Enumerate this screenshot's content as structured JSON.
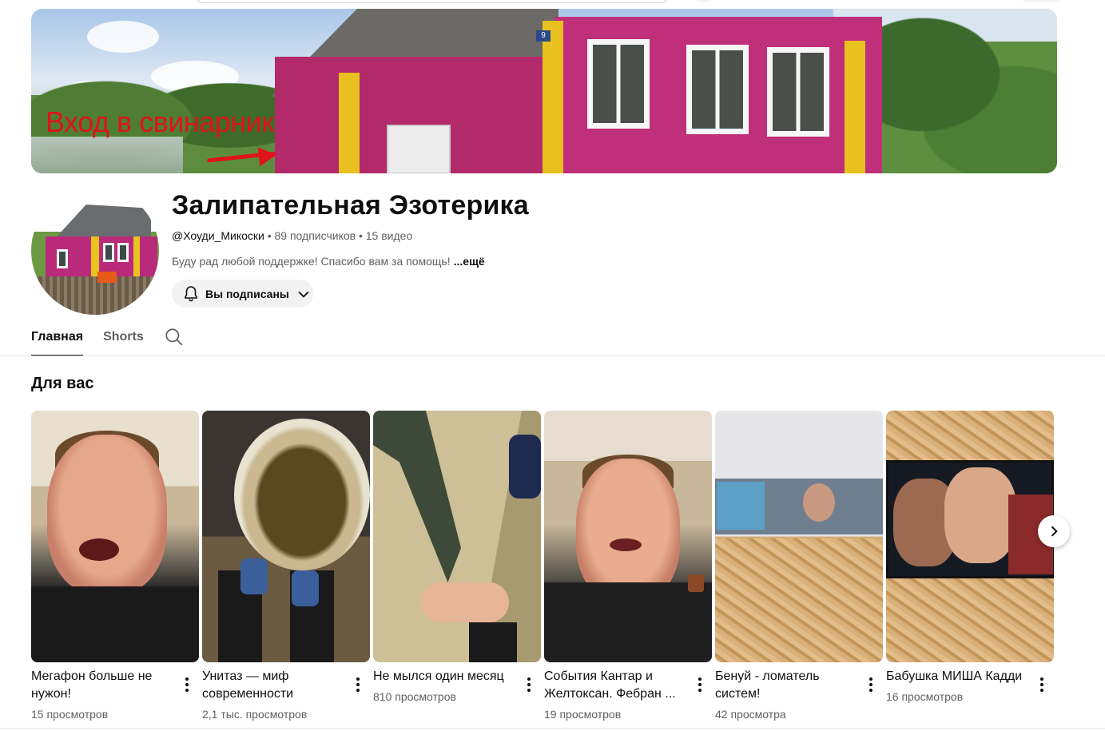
{
  "banner": {
    "overlay_text": "Вход в свинарник",
    "house_number": "9"
  },
  "channel": {
    "name": "Залипательная Эзотерика",
    "handle": "@Хоуди_Микоски",
    "subscribers": "89 подписчиков",
    "videos": "15 видео",
    "meta_separator": " • ",
    "description": "Буду рад любой поддержке! Спасибо вам за помощь!",
    "more_label": "...ещё",
    "subscribe_label": "Вы подписаны"
  },
  "tabs": [
    {
      "label": "Главная",
      "active": true
    },
    {
      "label": "Shorts",
      "active": false
    }
  ],
  "section": {
    "title": "Для вас"
  },
  "shorts": [
    {
      "title": "Мегафон больше не нужон!",
      "views": "15 просмотров",
      "title_lines": 2
    },
    {
      "title": "Унитаз — миф современности",
      "views": "2,1 тыс. просмотров",
      "title_lines": 2
    },
    {
      "title": "Не мылся один месяц",
      "views": "810 просмотров",
      "title_lines": 1
    },
    {
      "title": "События Кантар и Желтоксан. Фебран ...",
      "views": "19 просмотров",
      "title_lines": 2
    },
    {
      "title": "Бенуй - ломатель систем!",
      "views": "42 просмотра",
      "title_lines": 2
    },
    {
      "title": "Бабушка МИША Кадди",
      "views": "16 просмотров",
      "title_lines": 1
    }
  ],
  "icons": {
    "bell": "bell-icon",
    "chevron": "chevron-down-icon",
    "search": "search-icon",
    "more": "more-vert-icon",
    "next": "chevron-right-icon"
  }
}
